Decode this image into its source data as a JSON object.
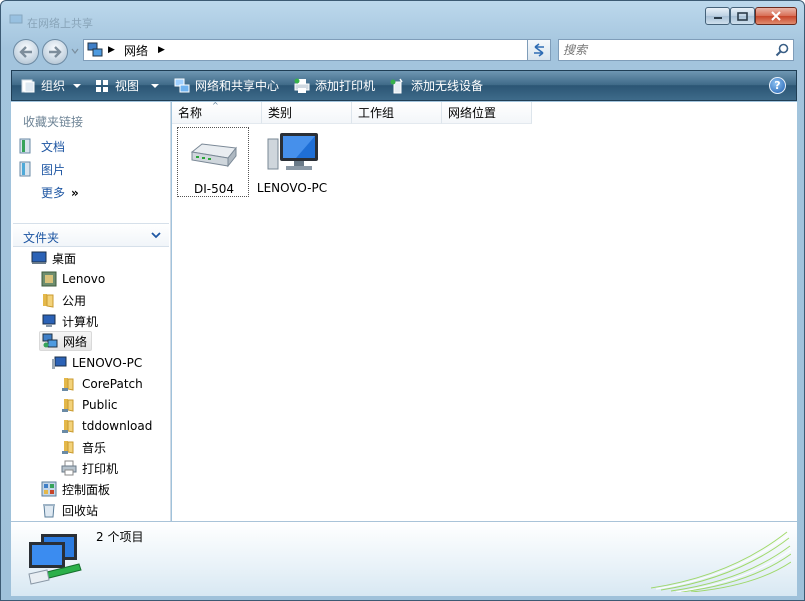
{
  "window": {
    "title": "在网络上共享",
    "buttons": {
      "minimize": "minimize",
      "maximize": "maximize",
      "close": "close"
    }
  },
  "navigation": {
    "address": {
      "crumb": "网络"
    },
    "search": {
      "placeholder": "搜索"
    }
  },
  "toolbar": {
    "organize": "组织",
    "views": "视图",
    "network_center": "网络和共享中心",
    "add_printer": "添加打印机",
    "add_wireless": "添加无线设备",
    "help": "?"
  },
  "sidebar": {
    "favorites_title": "收藏夹链接",
    "favorites": [
      {
        "label": "文档"
      },
      {
        "label": "图片"
      }
    ],
    "more": "更多",
    "folders_title": "文件夹",
    "tree": [
      {
        "label": "桌面"
      },
      {
        "label": "Lenovo"
      },
      {
        "label": "公用"
      },
      {
        "label": "计算机"
      },
      {
        "label": "网络"
      },
      {
        "label": "LENOVO-PC"
      },
      {
        "label": "CorePatch"
      },
      {
        "label": "Public"
      },
      {
        "label": "tddownload"
      },
      {
        "label": "音乐"
      },
      {
        "label": "打印机"
      },
      {
        "label": "控制面板"
      },
      {
        "label": "回收站"
      }
    ]
  },
  "content": {
    "columns": [
      "名称",
      "类别",
      "工作组",
      "网络位置"
    ],
    "items": [
      {
        "label": "DI-504",
        "icon": "router-icon"
      },
      {
        "label": "LENOVO-PC",
        "icon": "computer-icon"
      }
    ]
  },
  "status": {
    "count": "2 个项目"
  }
}
